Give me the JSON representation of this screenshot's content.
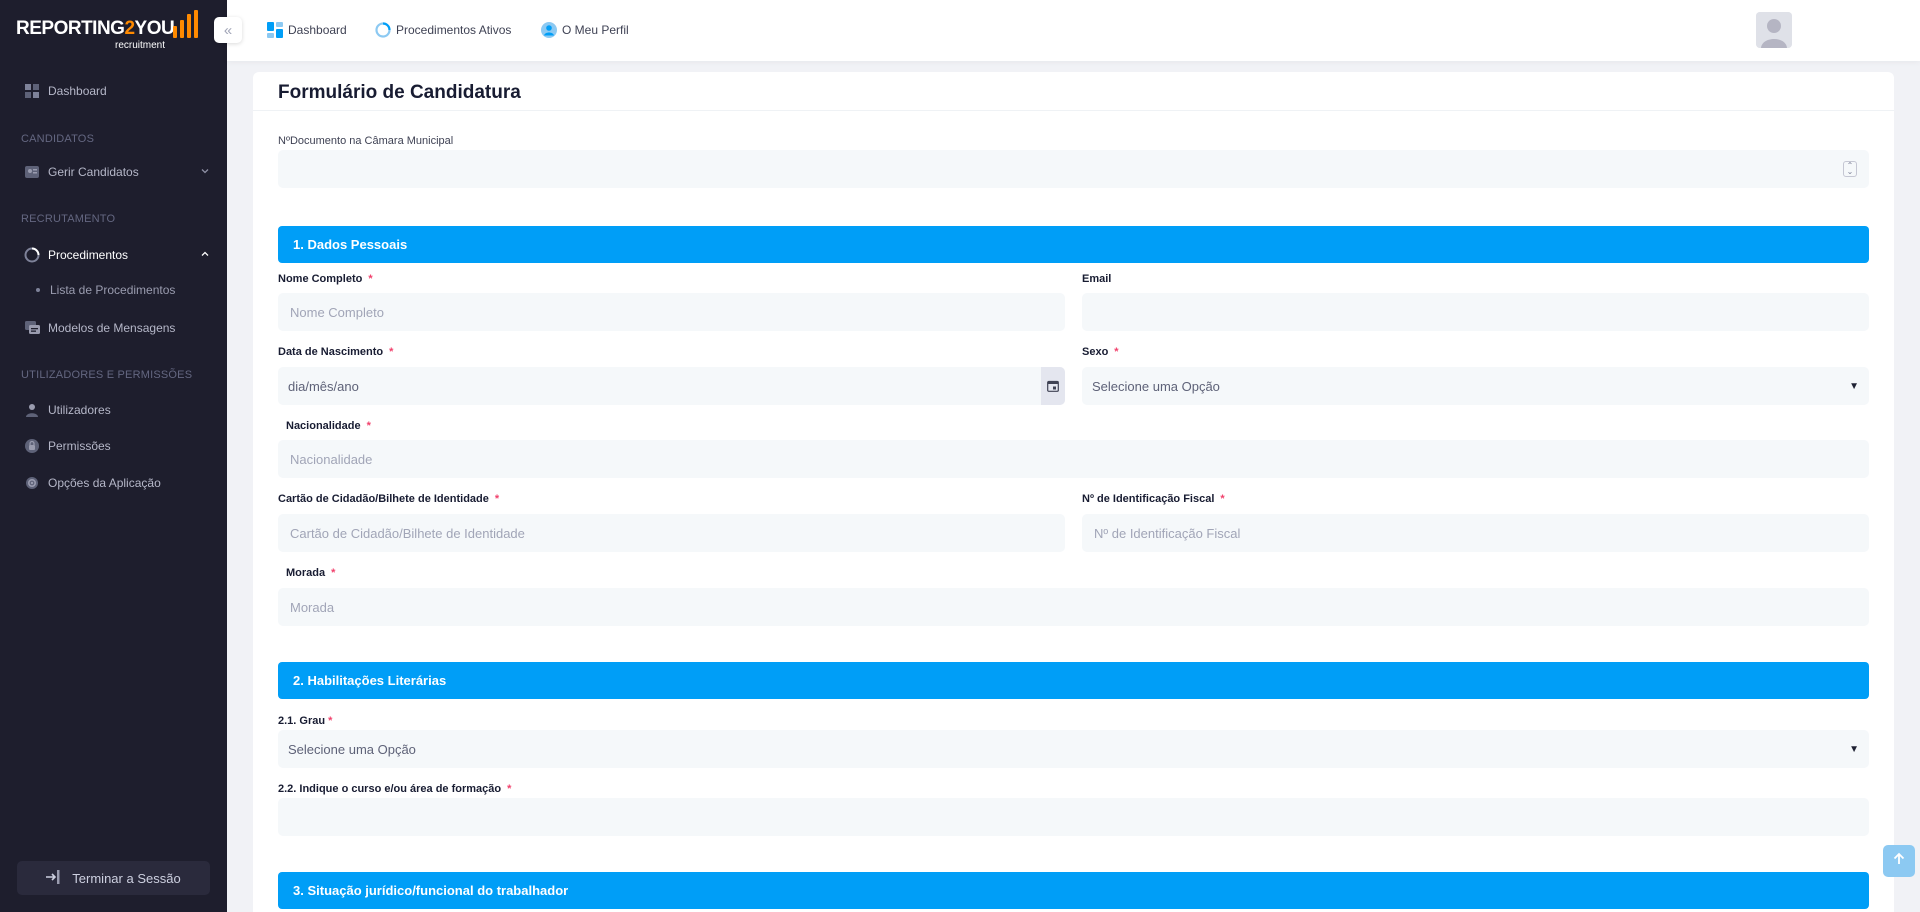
{
  "logo": {
    "main_prefix": "REPORTING",
    "main_accent": "2",
    "main_suffix": "YOU",
    "sub": "recruitment"
  },
  "sidebar": {
    "collapse_icon": "double-chevron-left-icon",
    "dashboard": "Dashboard",
    "section_candidates": "CANDIDATOS",
    "manage_candidates": "Gerir Candidatos",
    "section_recruitment": "RECRUTAMENTO",
    "procedures": "Procedimentos",
    "procedures_list": "Lista de Procedimentos",
    "message_templates": "Modelos de Mensagens",
    "section_users": "UTILIZADORES E PERMISSÕES",
    "users": "Utilizadores",
    "permissions": "Permissões",
    "app_options": "Opções da Aplicação",
    "logout": "Terminar a Sessão"
  },
  "header": {
    "nav": [
      "Dashboard",
      "Procedimentos Ativos",
      "O Meu Perfil"
    ]
  },
  "form": {
    "title": "Formulário de Candidatura",
    "doc_number_label": "NºDocumento na Câmara Municipal",
    "section1": "1. Dados Pessoais",
    "full_name_label": "Nome Completo",
    "full_name_placeholder": "Nome Completo",
    "email_label": "Email",
    "birth_label": "Data de Nascimento",
    "birth_value": "dia/mês/ano",
    "sex_label": "Sexo",
    "sex_value": "Selecione uma Opção",
    "nationality_label": "Nacionalidade",
    "nationality_placeholder": "Nacionalidade",
    "id_card_label": "Cartão de Cidadão/Bilhete de Identidade",
    "id_card_placeholder": "Cartão de Cidadão/Bilhete de Identidade",
    "nif_label": "Nº de Identificação Fiscal",
    "nif_placeholder": "Nº de Identificação Fiscal",
    "address_label": "Morada",
    "address_placeholder": "Morada",
    "section2": "2. Habilitações Literárias",
    "degree_label": "2.1. Grau",
    "degree_value": "Selecione uma Opção",
    "course_label": "2.2. Indique o curso e/ou área de formação",
    "section3": "3. Situação jurídico/funcional do trabalhador",
    "required_mark": "*"
  },
  "colors": {
    "sidebar_bg": "#1e1e2d",
    "accent_blue": "#009ef7",
    "brand_orange": "#ff8a00",
    "required": "#f1416c"
  }
}
